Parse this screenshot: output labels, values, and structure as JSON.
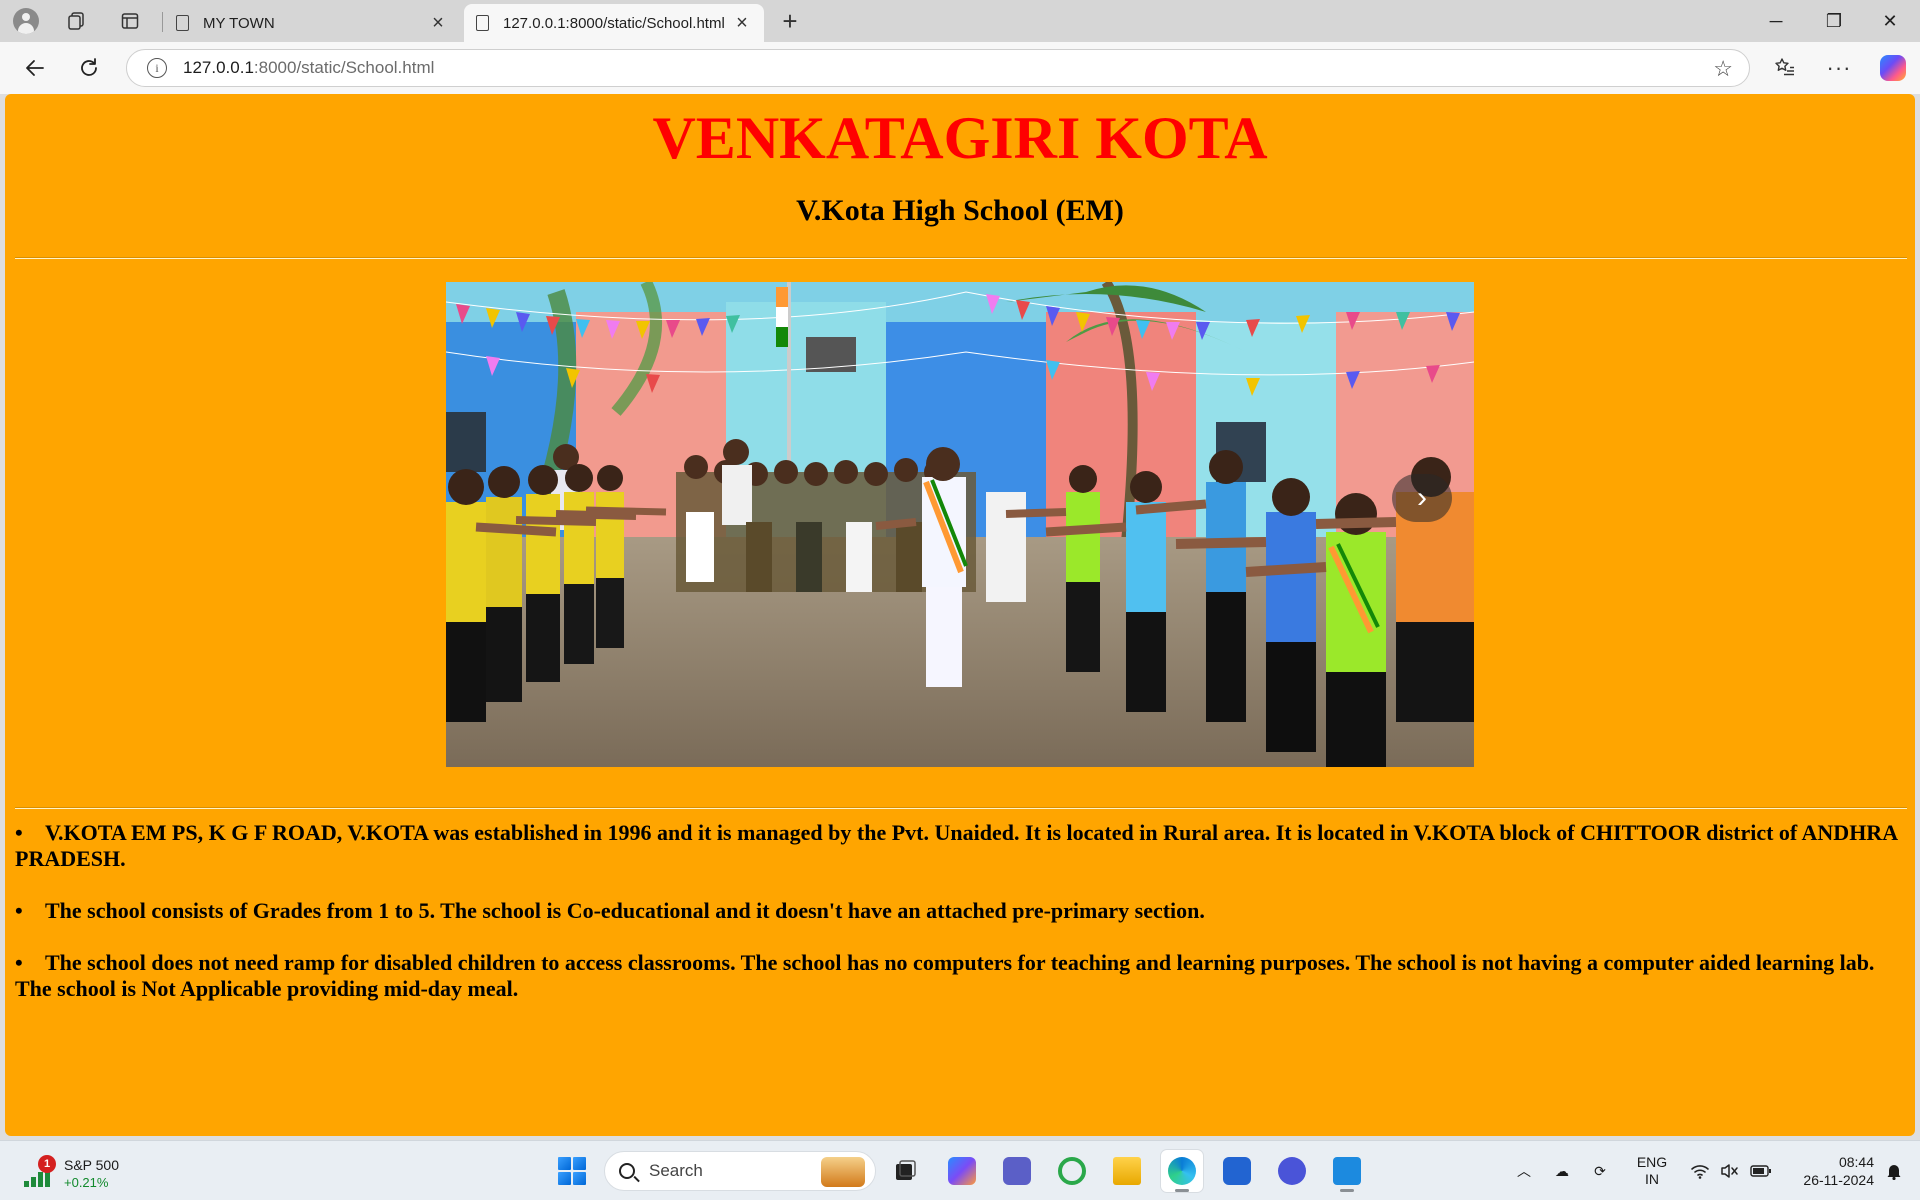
{
  "browser": {
    "tabs": [
      {
        "title": "MY TOWN",
        "active": false
      },
      {
        "title": "127.0.0.1:8000/static/School.html",
        "active": true
      }
    ],
    "address": {
      "host": "127.0.0.1",
      "path": ":8000/static/School.html"
    },
    "window_controls": {
      "minimize": "─",
      "maximize": "❐",
      "close": "✕"
    }
  },
  "page": {
    "title": "VENKATAGIRI KOTA",
    "subtitle": "V.Kota High School (EM)",
    "carousel": {
      "next_symbol": "›"
    },
    "info": [
      "V.KOTA EM PS, K G F ROAD, V.KOTA was established in 1996 and it is managed by the Pvt. Unaided. It is located in Rural area. It is located in V.KOTA block of CHITTOOR district of ANDHRA PRADESH.",
      "The school consists of Grades from 1 to 5. The school is Co-educational and it doesn't have an attached pre-primary section.",
      "The school does not need ramp for disabled children to access classrooms. The school has no computers for teaching and learning purposes. The school is not having a computer aided learning lab. The school is Not Applicable providing mid-day meal."
    ],
    "bullet": "•",
    "colors": {
      "background": "#ffa500",
      "title": "#ff0000"
    }
  },
  "taskbar": {
    "widget": {
      "name": "S&P 500",
      "value": "+0.21%",
      "badge": "1"
    },
    "search_placeholder": "Search",
    "tray": {
      "lang_top": "ENG",
      "lang_bottom": "IN",
      "time": "08:44",
      "date": "26-11-2024"
    }
  }
}
